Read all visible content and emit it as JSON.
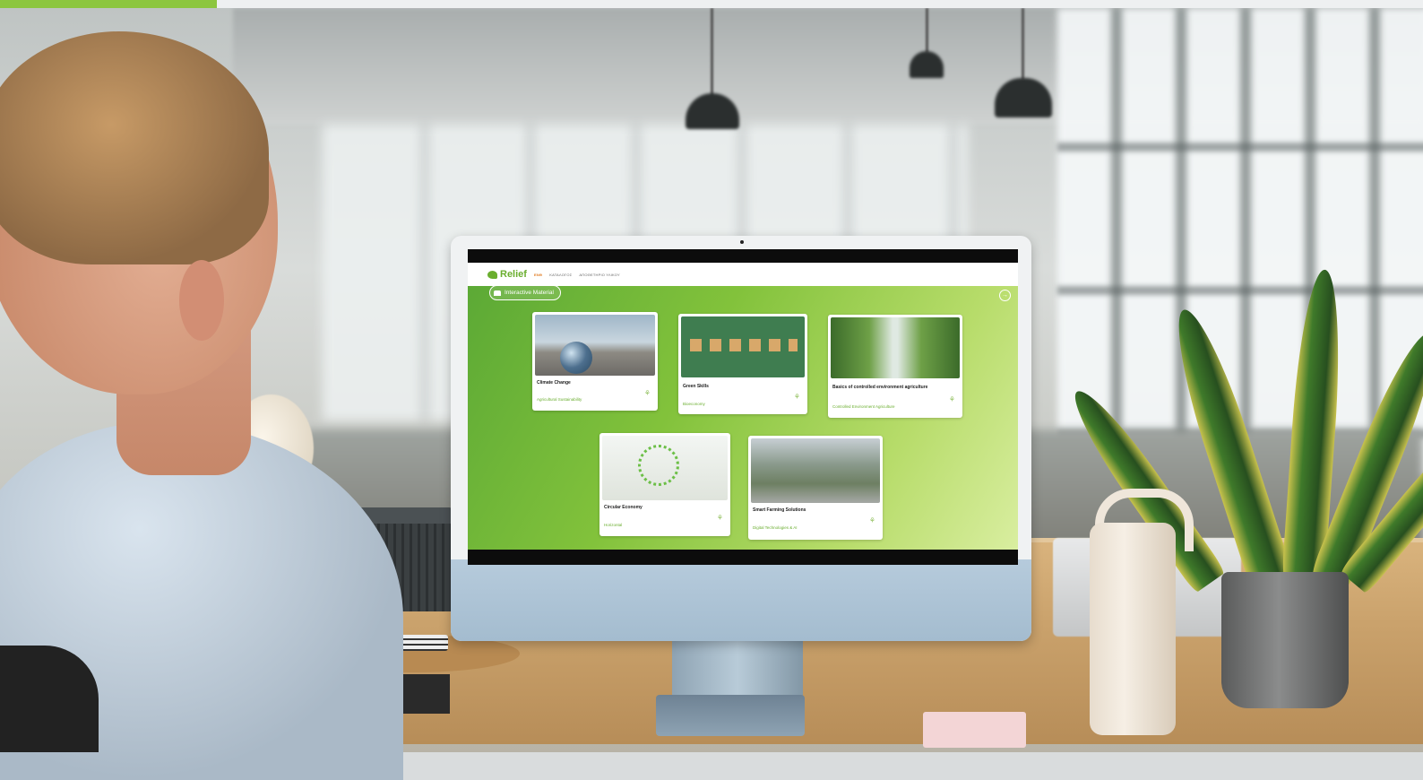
{
  "screen": {
    "brand": "Relief",
    "nav": [
      {
        "label": "ΕΝΘ",
        "active": true
      },
      {
        "label": "ΚΑΤΑΛΟΓΟΣ",
        "active": false
      },
      {
        "label": "ΑΠΟΘΕΤΗΡΙΟ ΥΛΙΚΟΥ",
        "active": false
      }
    ],
    "section_label": "Interactive Material",
    "cards": [
      {
        "title": "Climate Change",
        "subtitle": "Agricultural Sustainability",
        "image": "earth-on-beach"
      },
      {
        "title": "Green Skills",
        "subtitle": "Bioeconomy",
        "image": "green-wooden-blocks"
      },
      {
        "title": "Basics of controlled environment agriculture",
        "subtitle": "Controlled Environment Agriculture",
        "image": "greenhouse-rows"
      },
      {
        "title": "Circular Economy",
        "subtitle": "Horizontal",
        "image": "circular-economy-icons"
      },
      {
        "title": "Smart Farming Solutions",
        "subtitle": "Digital Technologies & AI",
        "image": "smart-farm-tablet"
      }
    ]
  },
  "icons": {
    "logo": "leaf-logo-icon",
    "section": "graduation-cap-icon",
    "next": "arrow-right-icon",
    "card": "sprout-icon"
  },
  "colors": {
    "accent": "#8cc63f",
    "brand_green": "#6aae2f",
    "active_nav": "#e07a1f"
  }
}
